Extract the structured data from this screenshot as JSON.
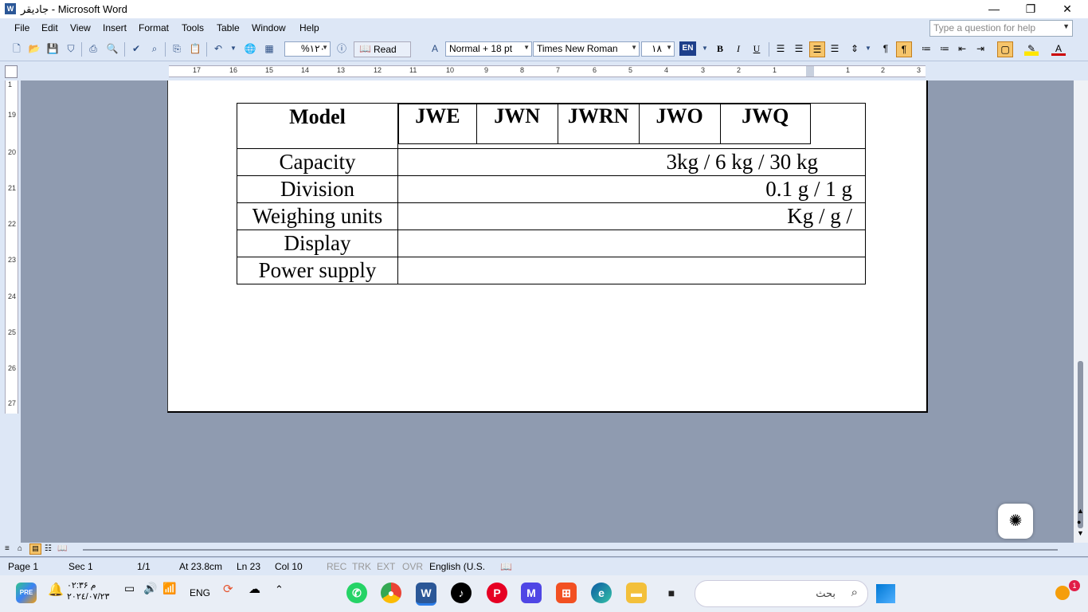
{
  "titlebar": {
    "icon": "W",
    "title": "جاديقر - Microsoft Word",
    "minimize": "—",
    "restore": "❐",
    "close": "✕"
  },
  "menubar": {
    "items": [
      "File",
      "Edit",
      "View",
      "Insert",
      "Format",
      "Tools",
      "Table",
      "Window",
      "Help"
    ],
    "help_placeholder": "Type a question for help"
  },
  "toolbar": {
    "zoom": "%۱۲۰",
    "read_label": "Read",
    "style": "Normal + 18 pt",
    "font": "Times New Roman",
    "size": "۱۸",
    "lang": "EN",
    "bold": "B",
    "italic": "I",
    "underline": "U"
  },
  "ruler": {
    "h_numbers": [
      "17",
      "16",
      "15",
      "14",
      "13",
      "12",
      "11",
      "10",
      "9",
      "8",
      "7",
      "6",
      "5",
      "4",
      "3",
      "2",
      "1",
      "1",
      "2",
      "3"
    ],
    "v_numbers": [
      "1",
      "19",
      "20",
      "21",
      "22",
      "23",
      "24",
      "25",
      "26",
      "27"
    ]
  },
  "table": {
    "header_label": "Model",
    "models": [
      "JWE",
      "JWN",
      "JWRN",
      "JWO",
      "JWQ"
    ],
    "rows": [
      {
        "label": "Capacity",
        "value": "3kg / 6 kg / 30 kg"
      },
      {
        "label": "Division",
        "value": "0.1 g / 1 g"
      },
      {
        "label": "Weighing units",
        "value": "Kg / g /"
      },
      {
        "label": "Display",
        "value": ""
      },
      {
        "label": "Power supply",
        "value": ""
      }
    ]
  },
  "statusbar": {
    "page": "Page 1",
    "sec": "Sec 1",
    "pages": "1/1",
    "at": "At 23.8cm",
    "ln": "Ln 23",
    "col": "Col 10",
    "rec": "REC",
    "trk": "TRK",
    "ext": "EXT",
    "ovr": "OVR",
    "language": "English (U.S."
  },
  "taskbar": {
    "lang": "ENG",
    "search_text": "بحث",
    "time": "۰۲:۳۶ م",
    "date": "۲۰۲٤/۰۷/۲۳",
    "notification_count": "1"
  },
  "colors": {
    "page_bg": "#8f9bb0",
    "chrome": "#dde7f6",
    "word_blue": "#2b5797"
  }
}
